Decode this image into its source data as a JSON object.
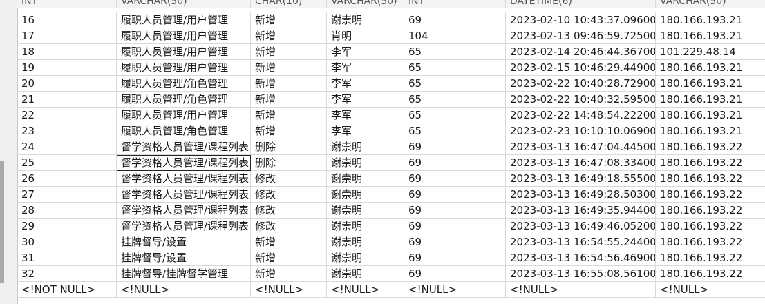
{
  "columns": [
    {
      "type": "INT"
    },
    {
      "type": "VARCHAR(50)"
    },
    {
      "type": "CHAR(10)"
    },
    {
      "type": "VARCHAR(50)"
    },
    {
      "type": "INT"
    },
    {
      "type": "DATETIME(6)"
    },
    {
      "type": "VARCHAR(50)"
    }
  ],
  "rows": [
    {
      "num": "16",
      "cells": [
        "16",
        "履职人员管理/用户管理",
        "新增",
        "谢崇明",
        "69",
        "2023-02-10 10:43:37.096000",
        "180.166.193.21"
      ]
    },
    {
      "num": "17",
      "cells": [
        "17",
        "履职人员管理/用户管理",
        "新增",
        "肖明",
        "104",
        "2023-02-13 09:46:59.725000",
        "180.166.193.21"
      ]
    },
    {
      "num": "18",
      "cells": [
        "18",
        "履职人员管理/用户管理",
        "新增",
        "李军",
        "65",
        "2023-02-14 20:46:44.367000",
        "101.229.48.14"
      ]
    },
    {
      "num": "19",
      "cells": [
        "19",
        "履职人员管理/用户管理",
        "新增",
        "李军",
        "65",
        "2023-02-15 10:46:29.449000",
        "180.166.193.21"
      ]
    },
    {
      "num": "20",
      "cells": [
        "20",
        "履职人员管理/角色管理",
        "新增",
        "李军",
        "65",
        "2023-02-22 10:40:28.729000",
        "180.166.193.21"
      ]
    },
    {
      "num": "21",
      "cells": [
        "21",
        "履职人员管理/角色管理",
        "新增",
        "李军",
        "65",
        "2023-02-22 10:40:32.595000",
        "180.166.193.21"
      ]
    },
    {
      "num": "22",
      "cells": [
        "22",
        "履职人员管理/用户管理",
        "新增",
        "李军",
        "65",
        "2023-02-22 14:48:54.222000",
        "180.166.193.21"
      ]
    },
    {
      "num": "23",
      "cells": [
        "23",
        "履职人员管理/角色管理",
        "新增",
        "李军",
        "65",
        "2023-02-23 10:10:10.069000",
        "180.166.193.21"
      ]
    },
    {
      "num": "24",
      "cells": [
        "24",
        "督学资格人员管理/课程列表",
        "删除",
        "谢崇明",
        "69",
        "2023-03-13 16:47:04.445000",
        "180.166.193.22"
      ]
    },
    {
      "num": "25",
      "cells": [
        "25",
        "督学资格人员管理/课程列表",
        "删除",
        "谢崇明",
        "69",
        "2023-03-13 16:47:08.334000",
        "180.166.193.22"
      ],
      "selected_col": 1
    },
    {
      "num": "26",
      "cells": [
        "26",
        "督学资格人员管理/课程列表",
        "修改",
        "谢崇明",
        "69",
        "2023-03-13 16:49:18.555000",
        "180.166.193.22"
      ]
    },
    {
      "num": "27",
      "cells": [
        "27",
        "督学资格人员管理/课程列表",
        "修改",
        "谢崇明",
        "69",
        "2023-03-13 16:49:28.503000",
        "180.166.193.22"
      ]
    },
    {
      "num": "28",
      "cells": [
        "28",
        "督学资格人员管理/课程列表",
        "修改",
        "谢崇明",
        "69",
        "2023-03-13 16:49:35.944000",
        "180.166.193.22"
      ]
    },
    {
      "num": "29",
      "cells": [
        "29",
        "督学资格人员管理/课程列表",
        "修改",
        "谢崇明",
        "69",
        "2023-03-13 16:49:46.052000",
        "180.166.193.22"
      ]
    },
    {
      "num": "30",
      "cells": [
        "30",
        "挂牌督导/设置",
        "新增",
        "谢崇明",
        "69",
        "2023-03-13 16:54:55.244000",
        "180.166.193.22"
      ]
    },
    {
      "num": "31",
      "cells": [
        "31",
        "挂牌督导/设置",
        "新增",
        "谢崇明",
        "69",
        "2023-03-13 16:54:56.469000",
        "180.166.193.22"
      ]
    },
    {
      "num": "32",
      "cells": [
        "32",
        "挂牌督导/挂牌督学管理",
        "新增",
        "谢崇明",
        "69",
        "2023-03-13 16:55:08.561000",
        "180.166.193.22"
      ]
    },
    {
      "num": "*",
      "cells": [
        "<!NOT NULL>",
        "<!NULL>",
        "<!NULL>",
        "<!NULL>",
        "<!NULL>",
        "<!NULL>",
        "<!NULL>"
      ]
    }
  ]
}
